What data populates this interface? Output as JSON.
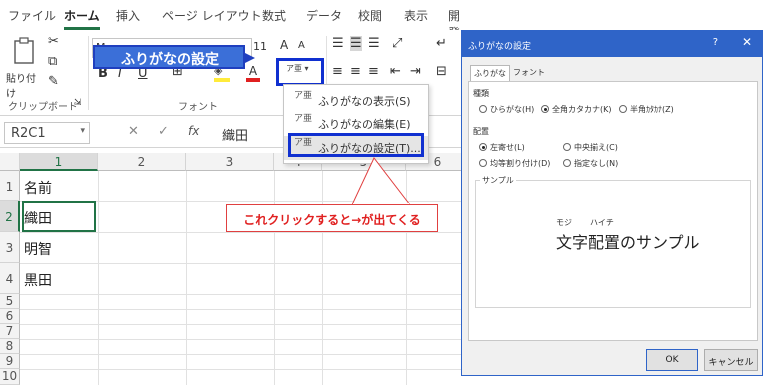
{
  "ribbon_tabs": [
    "ファイル",
    "ホーム",
    "挿入",
    "ページ レイアウト",
    "数式",
    "データ",
    "校閲",
    "表示",
    "開発"
  ],
  "active_tab": "ホーム",
  "clipboard": {
    "paste_label": "貼り付け",
    "group_label": "クリップボード"
  },
  "font_group": {
    "group_label": "フォント",
    "font_name": "M",
    "font_size": "11",
    "bold": "B",
    "italic": "I",
    "underline": "U",
    "color_a": "A",
    "grow": "A",
    "shrink": "A",
    "phonetic_icon": "ア亜"
  },
  "callout_top": "ふりがなの設定",
  "name_box": "R2C1",
  "formula_value": "織田",
  "fx_label": "fx",
  "columns": [
    "1",
    "2",
    "3",
    "4",
    "5",
    "6"
  ],
  "rows": [
    "1",
    "2",
    "3",
    "4",
    "5",
    "6",
    "7",
    "8",
    "9",
    "10"
  ],
  "cells": {
    "r1": "名前",
    "r2": "織田",
    "r3": "明智",
    "r4": "黒田"
  },
  "menu": [
    {
      "label": "ふりがなの表示(S)",
      "icon": "ア亜"
    },
    {
      "label": "ふりがなの編集(E)",
      "icon": "ア亜"
    },
    {
      "label": "ふりがなの設定(T)...",
      "icon": "ア亜"
    }
  ],
  "red_callout": "これクリックすると→が出てくる",
  "dialog": {
    "title": "ふりがなの設定",
    "help": "?",
    "close": "✕",
    "tabs": [
      "ふりがな",
      "フォント"
    ],
    "type_label": "種類",
    "type_options": [
      {
        "label": "ひらがな(H)",
        "checked": false
      },
      {
        "label": "全角カタカナ(K)",
        "checked": true
      },
      {
        "label": "半角ｶﾀｶﾅ(Z)",
        "checked": false
      }
    ],
    "align_label": "配置",
    "align_options": [
      {
        "label": "左寄せ(L)",
        "checked": true
      },
      {
        "label": "中央揃え(C)",
        "checked": false
      },
      {
        "label": "均等割り付け(D)",
        "checked": false
      },
      {
        "label": "指定なし(N)",
        "checked": false
      }
    ],
    "sample_label": "サンプル",
    "ruby_1": "モジ",
    "ruby_2": "ハイチ",
    "sample_text": "文字配置のサンプル",
    "ok": "OK",
    "cancel": "キャンセル"
  },
  "colors": {
    "excel_green": "#217346",
    "dialog_blue": "#2f64c8",
    "highlight_blue": "#1030d0",
    "callout_red": "#e02020"
  }
}
